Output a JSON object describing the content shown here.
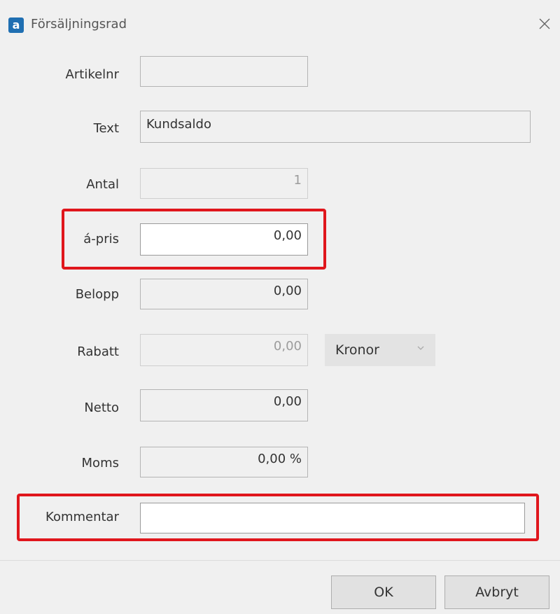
{
  "window": {
    "app_icon_letter": "a",
    "title": "Försäljningsrad"
  },
  "form": {
    "artikelnr": {
      "label": "Artikelnr",
      "value": ""
    },
    "text": {
      "label": "Text",
      "value": "Kundsaldo"
    },
    "antal": {
      "label": "Antal",
      "value": "1"
    },
    "a_pris": {
      "label": "á-pris",
      "value": "0,00"
    },
    "belopp": {
      "label": "Belopp",
      "value": "0,00"
    },
    "rabatt": {
      "label": "Rabatt",
      "value": "0,00",
      "unit_selected": "Kronor"
    },
    "netto": {
      "label": "Netto",
      "value": "0,00"
    },
    "moms": {
      "label": "Moms",
      "value": "0,00 %"
    },
    "kommentar": {
      "label": "Kommentar",
      "value": ""
    }
  },
  "buttons": {
    "ok_label": "OK",
    "cancel_label": "Avbryt"
  },
  "colors": {
    "highlight": "#e0161c",
    "app_icon": "#1f6fb2"
  }
}
